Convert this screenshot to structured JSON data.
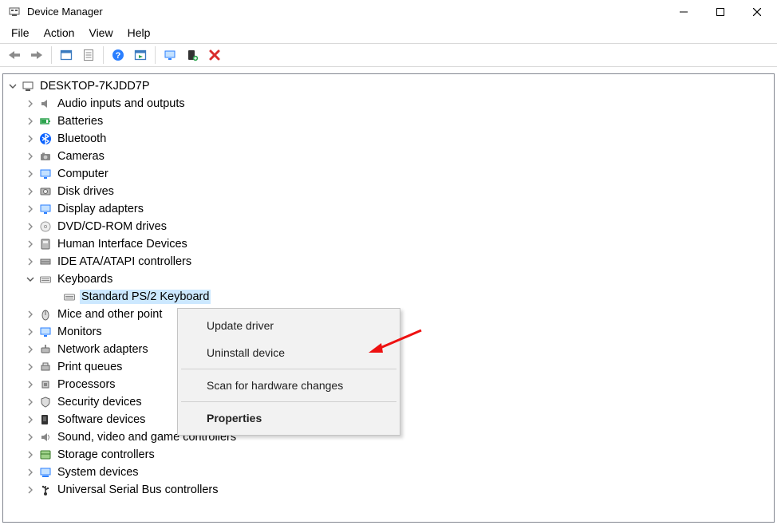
{
  "window": {
    "title": "Device Manager"
  },
  "menubar": [
    "File",
    "Action",
    "View",
    "Help"
  ],
  "toolbar_icons": [
    "back-arrow-icon",
    "forward-arrow-icon",
    "_sep",
    "show-hidden-icon",
    "_space",
    "properties-sheet-icon",
    "_sep",
    "help-icon",
    "action-window-icon",
    "_sep",
    "monitor-icon",
    "_space",
    "add-device-icon",
    "_space",
    "delete-x-icon"
  ],
  "tree": {
    "root": {
      "label": "DESKTOP-7KJDD7P",
      "icon": "computer-icon",
      "expanded": true
    },
    "categories": [
      {
        "label": "Audio inputs and outputs",
        "icon": "speaker-icon"
      },
      {
        "label": "Batteries",
        "icon": "battery-icon"
      },
      {
        "label": "Bluetooth",
        "icon": "bluetooth-icon"
      },
      {
        "label": "Cameras",
        "icon": "camera-icon"
      },
      {
        "label": "Computer",
        "icon": "monitor-icon"
      },
      {
        "label": "Disk drives",
        "icon": "disk-icon"
      },
      {
        "label": "Display adapters",
        "icon": "monitor-icon"
      },
      {
        "label": "DVD/CD-ROM drives",
        "icon": "disc-icon"
      },
      {
        "label": "Human Interface Devices",
        "icon": "hid-icon"
      },
      {
        "label": "IDE ATA/ATAPI controllers",
        "icon": "ide-icon"
      },
      {
        "label": "Keyboards",
        "icon": "keyboard-icon",
        "expanded": true,
        "children": [
          {
            "label": "Standard PS/2 Keyboard",
            "icon": "keyboard-icon",
            "selected": true
          }
        ]
      },
      {
        "label": "Mice and other point",
        "icon": "mouse-icon",
        "truncated": true
      },
      {
        "label": "Monitors",
        "icon": "monitor-icon"
      },
      {
        "label": "Network adapters",
        "icon": "network-icon"
      },
      {
        "label": "Print queues",
        "icon": "printer-icon"
      },
      {
        "label": "Processors",
        "icon": "cpu-icon"
      },
      {
        "label": "Security devices",
        "icon": "security-icon"
      },
      {
        "label": "Software devices",
        "icon": "software-icon"
      },
      {
        "label": "Sound, video and game controllers",
        "icon": "sound-icon"
      },
      {
        "label": "Storage controllers",
        "icon": "storage-icon"
      },
      {
        "label": "System devices",
        "icon": "system-icon"
      },
      {
        "label": "Universal Serial Bus controllers",
        "icon": "usb-icon"
      }
    ]
  },
  "context_menu": {
    "items": [
      {
        "label": "Update driver"
      },
      {
        "label": "Uninstall device"
      },
      "_sep",
      {
        "label": "Scan for hardware changes"
      },
      "_sep",
      {
        "label": "Properties",
        "default": true
      }
    ]
  }
}
